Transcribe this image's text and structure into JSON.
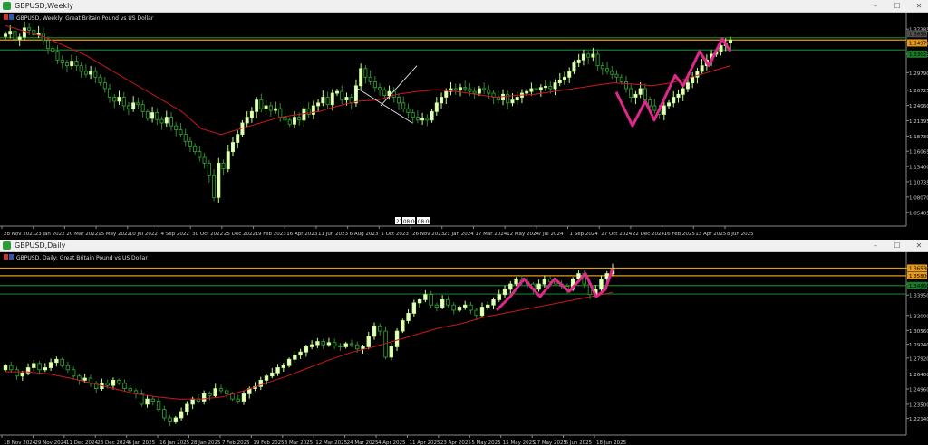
{
  "windows": {
    "weekly": {
      "title": "GBPUSD,Weekly",
      "buttons": [
        "–",
        "☐",
        "✕"
      ]
    },
    "daily": {
      "title": "GBPUSD,Daily",
      "buttons": [
        "–",
        "☐",
        "✕"
      ]
    }
  },
  "chart_data": [
    {
      "type": "candlestick",
      "symbol_label": "GBPUSD, Weekly:  Great Britain Pound vs US Dollar",
      "ylim": [
        1.03,
        1.3931
      ],
      "price_labels": [
        "1.37385",
        "1.34979",
        "1.33025",
        "1.29790",
        "1.26725",
        "1.24060",
        "1.21395",
        "1.18730",
        "1.16065",
        "1.13400",
        "1.10735",
        "1.08070",
        "1.05405"
      ],
      "price_values": [
        1.37385,
        1.34979,
        1.33025,
        1.2979,
        1.26725,
        1.2406,
        1.21395,
        1.1873,
        1.16065,
        1.134,
        1.10735,
        1.0807,
        1.05405
      ],
      "highlight_labels": [
        "1.36583",
        "1.34979",
        "1.33025"
      ],
      "highlight_values": [
        1.36583,
        1.34979,
        1.33025
      ],
      "highlight_colors": [
        "#505050",
        "#e69a1a",
        "#1a7a2a"
      ],
      "horizontal_levels": [
        {
          "value": 1.3548,
          "color": "#e69a1a"
        },
        {
          "value": 1.3375,
          "color": "#1a7a2a"
        },
        {
          "value": 1.3588,
          "color": "#1a7a2a"
        }
      ],
      "x_labels": [
        "28 Nov 2021",
        "23 Jan 2022",
        "20 Mar 2022",
        "15 May 2022",
        "10 Jul 2022",
        "4 Sep 2022",
        "30 Oct 2022",
        "25 Dec 2022",
        "19 Feb 2023",
        "16 Apr 2023",
        "11 Jun 2023",
        "6 Aug 2023",
        "1 Oct 2023",
        "26 Nov 2023",
        "21 Jan 2024",
        "17 Mar 2024",
        "12 May 2024",
        "7 Jul 2024",
        "1 Sep 2024",
        "27 Oct 2024",
        "22 Dec 2024",
        "16 Feb 2025",
        "13 Apr 2025",
        "8 Jun 2025"
      ],
      "cursor_labels": [
        "21",
        "08:00",
        "08:00"
      ],
      "series": [
        {
          "kind": "candles",
          "values": [
            1.365,
            1.37,
            1.356,
            1.36,
            1.376,
            1.372,
            1.364,
            1.367,
            1.354,
            1.34,
            1.335,
            1.32,
            1.315,
            1.31,
            1.318,
            1.31,
            1.3,
            1.295,
            1.3,
            1.29,
            1.28,
            1.27,
            1.255,
            1.248,
            1.255,
            1.24,
            1.235,
            1.245,
            1.242,
            1.23,
            1.218,
            1.228,
            1.216,
            1.21,
            1.22,
            1.205,
            1.198,
            1.19,
            1.178,
            1.17,
            1.16,
            1.15,
            1.14,
            1.118,
            1.08,
            1.14,
            1.13,
            1.16,
            1.176,
            1.19,
            1.21,
            1.22,
            1.23,
            1.25,
            1.235,
            1.24,
            1.232,
            1.235,
            1.22,
            1.215,
            1.208,
            1.22,
            1.215,
            1.235,
            1.225,
            1.24,
            1.245,
            1.255,
            1.242,
            1.262,
            1.265,
            1.25,
            1.255,
            1.245,
            1.275,
            1.305,
            1.29,
            1.282,
            1.272,
            1.268,
            1.258,
            1.265,
            1.255,
            1.245,
            1.235,
            1.228,
            1.22,
            1.215,
            1.218,
            1.215,
            1.23,
            1.245,
            1.255,
            1.265,
            1.27,
            1.268,
            1.272,
            1.27,
            1.265,
            1.262,
            1.27,
            1.268,
            1.262,
            1.255,
            1.25,
            1.26,
            1.245,
            1.25,
            1.255,
            1.262,
            1.265,
            1.27,
            1.268,
            1.272,
            1.274,
            1.27,
            1.28,
            1.285,
            1.29,
            1.3,
            1.315,
            1.32,
            1.33,
            1.325,
            1.33,
            1.31,
            1.305,
            1.3,
            1.295,
            1.29,
            1.282,
            1.27,
            1.255,
            1.26,
            1.27,
            1.25,
            1.24,
            1.232,
            1.225,
            1.24,
            1.245,
            1.255,
            1.26,
            1.27,
            1.28,
            1.29,
            1.3,
            1.31,
            1.32,
            1.33,
            1.335,
            1.345,
            1.35,
            1.355
          ]
        },
        {
          "kind": "ma",
          "values": [
            1.38,
            1.37,
            1.36,
            1.345,
            1.33,
            1.31,
            1.29,
            1.27,
            1.25,
            1.23,
            1.2,
            1.19,
            1.2,
            1.21,
            1.22,
            1.225,
            1.23,
            1.24,
            1.248,
            1.25,
            1.26,
            1.265,
            1.268,
            1.265,
            1.26,
            1.255,
            1.258,
            1.26,
            1.265,
            1.27,
            1.275,
            1.28,
            1.278,
            1.275,
            1.28,
            1.29,
            1.3,
            1.31
          ]
        }
      ]
    },
    {
      "type": "candlestick",
      "symbol_label": "GBPUSD, Daily:  Great Britain Pound vs US Dollar",
      "ylim": [
        1.2055,
        1.3752
      ],
      "price_labels": [
        "1.36530",
        "1.35000",
        "1.33950",
        "1.32000",
        "1.30560",
        "1.29240",
        "1.27920",
        "1.26400",
        "1.24960",
        "1.23500",
        "1.22140"
      ],
      "price_values": [
        1.3653,
        1.35,
        1.3395,
        1.32,
        1.3056,
        1.2924,
        1.2792,
        1.264,
        1.2496,
        1.235,
        1.2214
      ],
      "highlight_labels": [
        "1.36530",
        "1.35800",
        "1.34860"
      ],
      "highlight_values": [
        1.3653,
        1.358,
        1.3486
      ],
      "highlight_colors": [
        "#e69a1a",
        "#e69a1a",
        "#1a7a2a"
      ],
      "horizontal_levels": [
        {
          "value": 1.3653,
          "color": "#e69a1a"
        },
        {
          "value": 1.358,
          "color": "#e69a1a"
        },
        {
          "value": 1.3486,
          "color": "#1a7a2a"
        },
        {
          "value": 1.3405,
          "color": "#1a7a2a"
        }
      ],
      "x_labels": [
        "18 Nov 2024",
        "29 Nov 2024",
        "11 Dec 2024",
        "23 Dec 2024",
        "6 Jan 2025",
        "16 Jan 2025",
        "28 Jan 2025",
        "7 Feb 2025",
        "19 Feb 2025",
        "3 Mar 2025",
        "12 Mar 2025",
        "24 Mar 2025",
        "4 Apr 2025",
        "11 Apr 2025",
        "23 Apr 2025",
        "5 May 2025",
        "15 May 2025",
        "27 May 2025",
        "6 Jun 2025",
        "18 Jun 2025"
      ],
      "series": [
        {
          "kind": "candles",
          "values": [
            1.272,
            1.268,
            1.262,
            1.265,
            1.27,
            1.274,
            1.268,
            1.27,
            1.275,
            1.278,
            1.272,
            1.268,
            1.262,
            1.258,
            1.26,
            1.255,
            1.25,
            1.255,
            1.253,
            1.258,
            1.255,
            1.25,
            1.248,
            1.245,
            1.235,
            1.24,
            1.238,
            1.23,
            1.222,
            1.218,
            1.222,
            1.228,
            1.235,
            1.24,
            1.238,
            1.245,
            1.243,
            1.25,
            1.248,
            1.245,
            1.24,
            1.238,
            1.245,
            1.25,
            1.252,
            1.258,
            1.262,
            1.265,
            1.27,
            1.272,
            1.278,
            1.282,
            1.285,
            1.29,
            1.292,
            1.295,
            1.292,
            1.294,
            1.291,
            1.29,
            1.293,
            1.292,
            1.288,
            1.29,
            1.3,
            1.31,
            1.305,
            1.28,
            1.29,
            1.305,
            1.315,
            1.322,
            1.332,
            1.335,
            1.34,
            1.33,
            1.328,
            1.335,
            1.33,
            1.325,
            1.328,
            1.33,
            1.325,
            1.32,
            1.328,
            1.33,
            1.335,
            1.34,
            1.345,
            1.35,
            1.355,
            1.352,
            1.35,
            1.345,
            1.35,
            1.355,
            1.352,
            1.35,
            1.348,
            1.345,
            1.355,
            1.36,
            1.35,
            1.34,
            1.345,
            1.355,
            1.36,
            1.365
          ]
        },
        {
          "kind": "ma",
          "values": [
            1.266,
            1.266,
            1.264,
            1.26,
            1.255,
            1.25,
            1.245,
            1.242,
            1.24,
            1.24,
            1.242,
            1.248,
            1.255,
            1.262,
            1.27,
            1.278,
            1.285,
            1.29,
            1.296,
            1.302,
            1.308,
            1.312,
            1.318,
            1.322,
            1.326,
            1.33,
            1.334,
            1.338,
            1.342
          ]
        }
      ]
    }
  ]
}
